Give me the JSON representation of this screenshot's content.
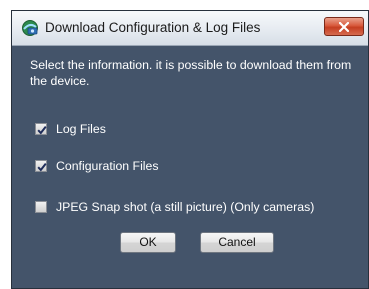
{
  "dialog": {
    "title": "Download Configuration & Log Files",
    "app_icon": "network-device-icon",
    "close_icon": "close-icon"
  },
  "content": {
    "description": "Select the information. it is possible to download them from the device."
  },
  "options": [
    {
      "label": "Log Files",
      "checked": true
    },
    {
      "label": "Configuration Files",
      "checked": true
    },
    {
      "label": "JPEG Snap shot (a still picture) (Only cameras)",
      "checked": false
    }
  ],
  "buttons": {
    "ok": "OK",
    "cancel": "Cancel"
  },
  "colors": {
    "dialog_background": "#44546a",
    "close_button": "#c53e21"
  }
}
